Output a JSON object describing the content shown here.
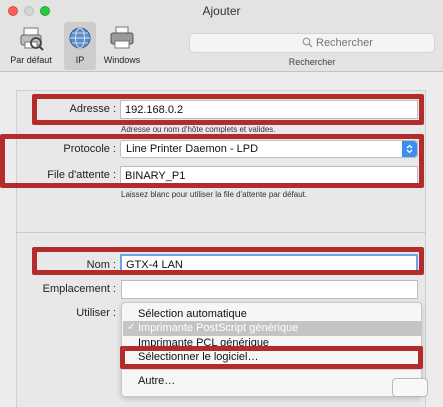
{
  "window": {
    "title": "Ajouter"
  },
  "toolbar": {
    "items": [
      {
        "label": "Par défaut",
        "icon": "default-printer-icon"
      },
      {
        "label": "IP",
        "icon": "globe-icon"
      },
      {
        "label": "Windows",
        "icon": "windows-printer-icon"
      }
    ],
    "search_placeholder": "Rechercher",
    "search_caption": "Rechercher"
  },
  "form": {
    "address_label": "Adresse :",
    "address_value": "192.168.0.2",
    "address_hint": "Adresse ou nom d'hôte complets et valides.",
    "protocol_label": "Protocole :",
    "protocol_value": "Line Printer Daemon - LPD",
    "queue_label": "File d'attente :",
    "queue_value": "BINARY_P1",
    "queue_hint": "Laissez blanc pour utiliser la file d'attente par défaut.",
    "name_label": "Nom :",
    "name_value": "GTX-4 LAN",
    "location_label": "Emplacement :",
    "location_value": "",
    "use_label": "Utiliser :"
  },
  "use_menu": {
    "items": [
      "Sélection automatique",
      "Imprimante PostScript générique",
      "Imprimante PCL générique",
      "Sélectionner le logiciel…",
      "Autre…"
    ]
  },
  "colors": {
    "highlight": "#b32b2b",
    "accent": "#3b8ef0",
    "focus": "#6ea2e6"
  }
}
